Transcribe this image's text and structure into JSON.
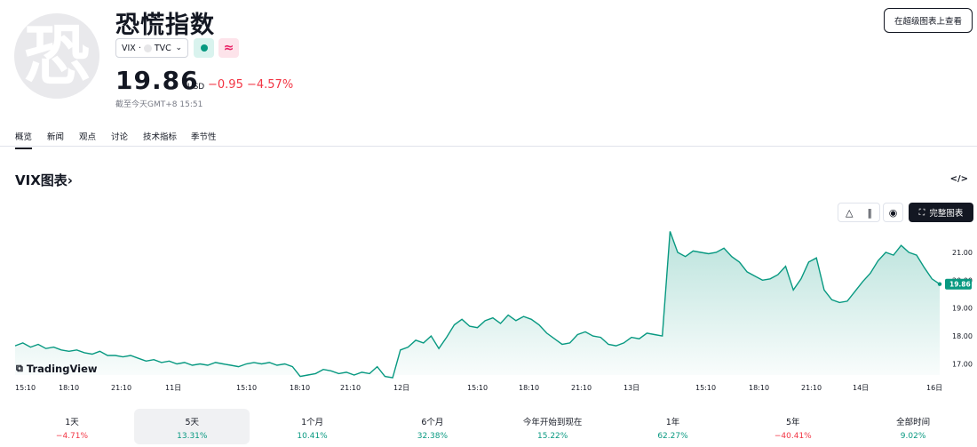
{
  "header": {
    "logo_glyph": "恐",
    "title": "恐慌指数",
    "symbol": "VIX",
    "separator": "·",
    "exchange": "TVC",
    "price": "19.86",
    "currency": "USD",
    "change": "−0.95",
    "change_pct": "−4.57%",
    "as_of": "截至今天GMT+8 15:51",
    "super_chart_button": "在超级图表上查看",
    "badge_wave_glyph": "≈"
  },
  "tabs": [
    "概览",
    "新闻",
    "观点",
    "讨论",
    "技术指标",
    "季节性"
  ],
  "chart_section": {
    "title": "VIX图表",
    "title_arrow": "›",
    "embed_label": "</>",
    "full_chart_label": "完整图表",
    "brand": "TradingView",
    "last_price_label": "19.86"
  },
  "colors": {
    "accent_line": "#089981",
    "area_fill": "#089981",
    "negative": "#f23645",
    "positive": "#089981"
  },
  "chart_data": {
    "type": "area",
    "x_tick_labels": [
      "15:10",
      "18:10",
      "21:10",
      "11日",
      "15:10",
      "18:10",
      "21:10",
      "12日",
      "15:10",
      "18:10",
      "21:10",
      "13日",
      "15:10",
      "18:10",
      "21:10",
      "14日",
      "16日"
    ],
    "y_tick_labels": [
      "21.00",
      "20.00",
      "19.00",
      "18.00",
      "17.00"
    ],
    "y_range": [
      16.6,
      21.7
    ],
    "grid": false,
    "values": [
      17.65,
      17.75,
      17.6,
      17.7,
      17.55,
      17.6,
      17.5,
      17.45,
      17.5,
      17.4,
      17.35,
      17.45,
      17.3,
      17.3,
      17.25,
      17.3,
      17.2,
      17.1,
      17.15,
      17.05,
      17.1,
      17.0,
      17.05,
      16.95,
      17.0,
      16.95,
      17.05,
      17.0,
      16.95,
      16.9,
      17.0,
      17.05,
      17.0,
      17.05,
      16.95,
      17.0,
      16.9,
      16.55,
      16.6,
      16.65,
      16.8,
      16.75,
      16.65,
      16.7,
      16.6,
      16.7,
      16.65,
      16.9,
      16.55,
      16.5,
      17.5,
      17.6,
      17.85,
      17.75,
      18.0,
      17.55,
      17.95,
      18.4,
      18.6,
      18.35,
      18.3,
      18.55,
      18.65,
      18.45,
      18.75,
      18.55,
      18.7,
      18.6,
      18.4,
      18.1,
      17.9,
      17.7,
      17.75,
      18.05,
      18.15,
      18.0,
      17.95,
      17.7,
      17.65,
      17.75,
      17.95,
      17.9,
      18.1,
      18.05,
      18.0,
      21.75,
      21.0,
      20.85,
      21.05,
      21.0,
      20.95,
      21.0,
      21.15,
      20.85,
      20.65,
      20.3,
      20.15,
      20.0,
      20.05,
      20.2,
      20.5,
      19.65,
      20.05,
      20.65,
      20.8,
      19.65,
      19.3,
      19.2,
      19.25,
      19.6,
      19.95,
      20.25,
      20.7,
      21.0,
      20.9,
      21.25,
      21.0,
      20.9,
      20.45,
      20.05,
      19.86
    ]
  },
  "ranges": [
    {
      "label": "1天",
      "value": "−4.71%",
      "dir": "down"
    },
    {
      "label": "5天",
      "value": "13.31%",
      "dir": "up"
    },
    {
      "label": "1个月",
      "value": "10.41%",
      "dir": "up"
    },
    {
      "label": "6个月",
      "value": "32.38%",
      "dir": "up"
    },
    {
      "label": "今年开始到现在",
      "value": "15.22%",
      "dir": "up"
    },
    {
      "label": "1年",
      "value": "62.27%",
      "dir": "up"
    },
    {
      "label": "5年",
      "value": "−40.41%",
      "dir": "down"
    },
    {
      "label": "全部时间",
      "value": "9.02%",
      "dir": "up"
    }
  ],
  "active_range": 1
}
